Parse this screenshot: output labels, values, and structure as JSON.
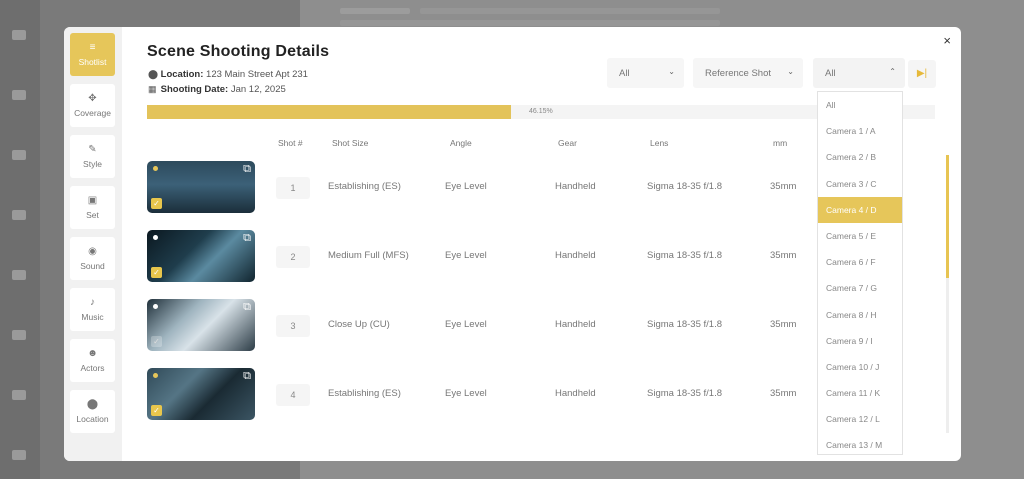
{
  "colors": {
    "accent": "#e6c65a",
    "progress": "#e3c35a"
  },
  "modal": {
    "title": "Scene Shooting Details",
    "location_label": "Location:",
    "location_value": "123 Main Street Apt 231",
    "date_label": "Shooting Date:",
    "date_value": "Jan 12, 2025",
    "close_icon": "×"
  },
  "rail": [
    {
      "icon": "list-icon",
      "glyph": "≡",
      "label": "Shotlist",
      "active": true
    },
    {
      "icon": "move-icon",
      "glyph": "✥",
      "label": "Coverage"
    },
    {
      "icon": "wand-icon",
      "glyph": "✎",
      "label": "Style"
    },
    {
      "icon": "set-icon",
      "glyph": "▣",
      "label": "Set"
    },
    {
      "icon": "sound-icon",
      "glyph": "◉",
      "label": "Sound"
    },
    {
      "icon": "music-icon",
      "glyph": "♪",
      "label": "Music"
    },
    {
      "icon": "actors-icon",
      "glyph": "☻",
      "label": "Actors"
    },
    {
      "icon": "location-pin-icon",
      "glyph": "⬤",
      "label": "Location"
    }
  ],
  "filters": {
    "first": "All",
    "second": "Reference Shot",
    "camera": "All"
  },
  "progress": {
    "value": 46.15,
    "label": "46.15%"
  },
  "table": {
    "headers": [
      "Shot #",
      "Shot Size",
      "Angle",
      "Gear",
      "Lens",
      "mm"
    ],
    "rows": [
      {
        "num": "1",
        "size": "Establishing (ES)",
        "angle": "Eye Level",
        "gear": "Handheld",
        "lens": "Sigma 18-35 f/1.8",
        "mm": "35mm",
        "checked": true,
        "dot": "#e6c65a"
      },
      {
        "num": "2",
        "size": "Medium Full (MFS)",
        "angle": "Eye Level",
        "gear": "Handheld",
        "lens": "Sigma 18-35 f/1.8",
        "mm": "35mm",
        "checked": true,
        "dot": "#ffffff"
      },
      {
        "num": "3",
        "size": "Close Up (CU)",
        "angle": "Eye Level",
        "gear": "Handheld",
        "lens": "Sigma 18-35 f/1.8",
        "mm": "35mm",
        "checked": false,
        "dot": "#ffffff"
      },
      {
        "num": "4",
        "size": "Establishing (ES)",
        "angle": "Eye Level",
        "gear": "Handheld",
        "lens": "Sigma 18-35 f/1.8",
        "mm": "35mm",
        "checked": true,
        "dot": "#e6c65a"
      }
    ]
  },
  "camera_options": [
    "All",
    "Camera 1 / A",
    "Camera 2 / B",
    "Camera 3 / C",
    "Camera 4 / D",
    "Camera 5 / E",
    "Camera 6 / F",
    "Camera 7 / G",
    "Camera 8 / H",
    "Camera 9 / I",
    "Camera 10 / J",
    "Camera 11 / K",
    "Camera 12 / L",
    "Camera 13 / M"
  ],
  "camera_selected_index": 4
}
